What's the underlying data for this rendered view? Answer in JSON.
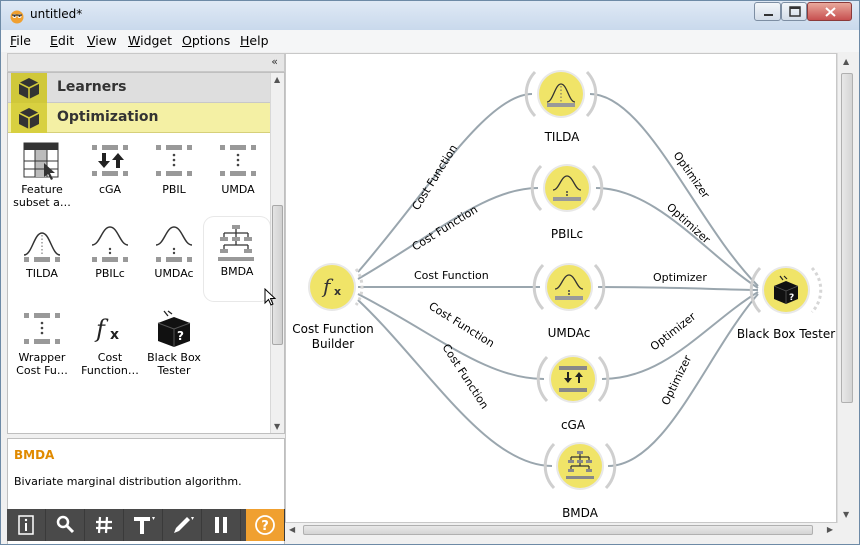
{
  "window": {
    "title": "untitled*"
  },
  "menubar": {
    "items": [
      {
        "underline": "F",
        "rest": "ile"
      },
      {
        "underline": "E",
        "rest": "dit"
      },
      {
        "underline": "V",
        "rest": "iew"
      },
      {
        "underline": "W",
        "rest": "idget"
      },
      {
        "underline": "O",
        "rest": "ptions"
      },
      {
        "underline": "H",
        "rest": "elp"
      }
    ]
  },
  "toolbox": {
    "collapse_icon": "«",
    "categories": [
      {
        "label": "Learners",
        "icon": "cube-icon"
      },
      {
        "label": "Optimization",
        "icon": "cube-icon"
      }
    ],
    "widgets": [
      {
        "label": "Feature subset a…",
        "icon": "feature-subset-icon"
      },
      {
        "label": "cGA",
        "icon": "cga-icon"
      },
      {
        "label": "PBIL",
        "icon": "pbil-icon"
      },
      {
        "label": "UMDA",
        "icon": "umda-icon"
      },
      {
        "label": "TILDA",
        "icon": "tilda-icon"
      },
      {
        "label": "PBILc",
        "icon": "pbilc-icon"
      },
      {
        "label": "UMDAc",
        "icon": "umdac-icon"
      },
      {
        "label": "BMDA",
        "icon": "bmda-icon"
      },
      {
        "label": "Wrapper Cost Fu…",
        "icon": "wrapper-icon"
      },
      {
        "label": "Cost Function…",
        "icon": "fx-icon"
      },
      {
        "label": "Black Box Tester",
        "icon": "black-box-icon"
      }
    ],
    "selected": "BMDA"
  },
  "description": {
    "title": "BMDA",
    "text": "Bivariate marginal distribution algorithm."
  },
  "bottom_toolbar": {
    "buttons": [
      "info-icon",
      "search-icon",
      "grid-icon",
      "text-icon",
      "pen-icon",
      "pause-icon",
      "help-icon"
    ],
    "help_glyph": "?"
  },
  "canvas": {
    "nodes": [
      {
        "label": "TILDA"
      },
      {
        "label": "PBILc"
      },
      {
        "label": "UMDAc"
      },
      {
        "label": "cGA"
      },
      {
        "label": "BMDA"
      },
      {
        "label": "Cost Function\nBuilder"
      },
      {
        "label": "Black Box Tester"
      }
    ],
    "link_labels": {
      "input": "Cost Function",
      "output": "Optimizer"
    }
  },
  "colors": {
    "node_fill": "#f0e468",
    "node_ring": "#e2e2e2",
    "link": "#9aa6ae",
    "accent": "#f0a030",
    "description_title": "#e08a00"
  }
}
